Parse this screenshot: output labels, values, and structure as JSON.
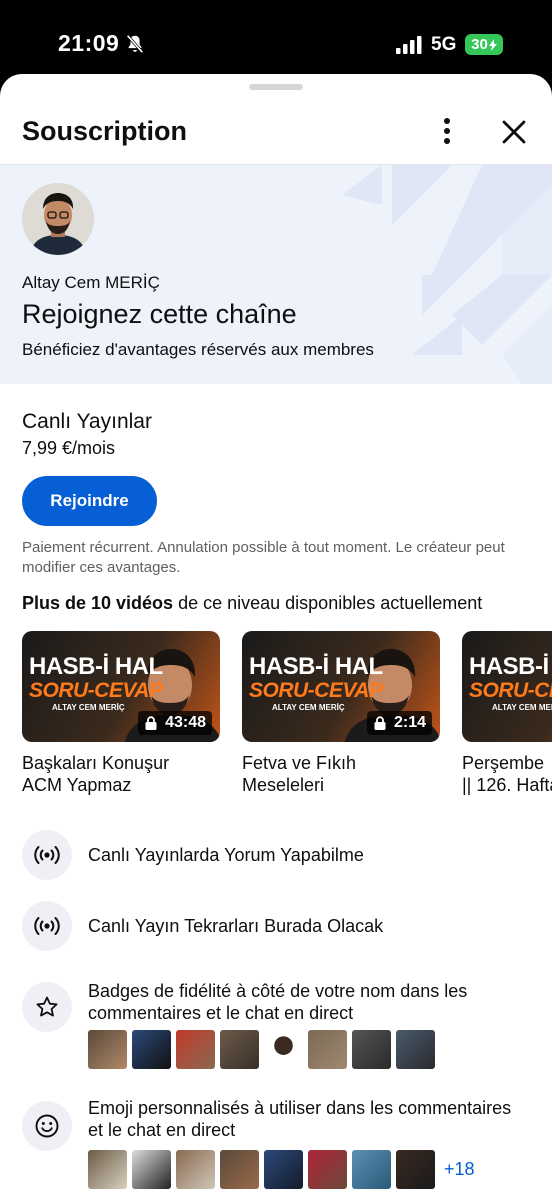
{
  "status_bar": {
    "time": "21:09",
    "network": "5G",
    "battery": "30"
  },
  "sheet": {
    "title": "Souscription"
  },
  "channel": {
    "name": "Altay Cem MERİÇ",
    "heading": "Rejoignez cette chaîne",
    "subheading": "Bénéficiez d'avantages réservés aux membres"
  },
  "tier": {
    "name": "Canlı Yayınlar",
    "price": "7,99 €/mois",
    "join_label": "Rejoindre",
    "terms": "Paiement récurrent. Annulation possible à tout moment. Le créateur peut modifier ces avantages."
  },
  "videos": {
    "heading_bold": "Plus de 10 vidéos",
    "heading_rest": " de ce niveau disponibles actuellement",
    "thumb_line1": "HASB-İ HAL",
    "thumb_line2": "SORU-CEVAP",
    "thumb_brand": "ALTAY CEM MERİÇ",
    "items": [
      {
        "duration": "43:48",
        "title_line1": "Başkaları Konuşur",
        "title_line2": "ACM Yapmaz"
      },
      {
        "duration": "2:14",
        "title_line1": "Fetva ve Fıkıh",
        "title_line2": "Meseleleri"
      },
      {
        "duration": "",
        "title_line1": "Perşembe",
        "title_line2": "|| 126. Hafta"
      }
    ]
  },
  "perks": [
    {
      "icon": "live-broadcast-icon",
      "text": "Canlı Yayınlarda Yorum Yapabilme"
    },
    {
      "icon": "live-broadcast-icon",
      "text": "Canlı Yayın Tekrarları Burada Olacak"
    },
    {
      "icon": "star-icon",
      "text": "Badges de fidélité à côté de votre nom dans les commentaires et le chat en direct"
    },
    {
      "icon": "smiley-icon",
      "text": "Emoji personnalisés à utiliser dans les commentaires et le chat en direct",
      "more": "+18"
    }
  ]
}
